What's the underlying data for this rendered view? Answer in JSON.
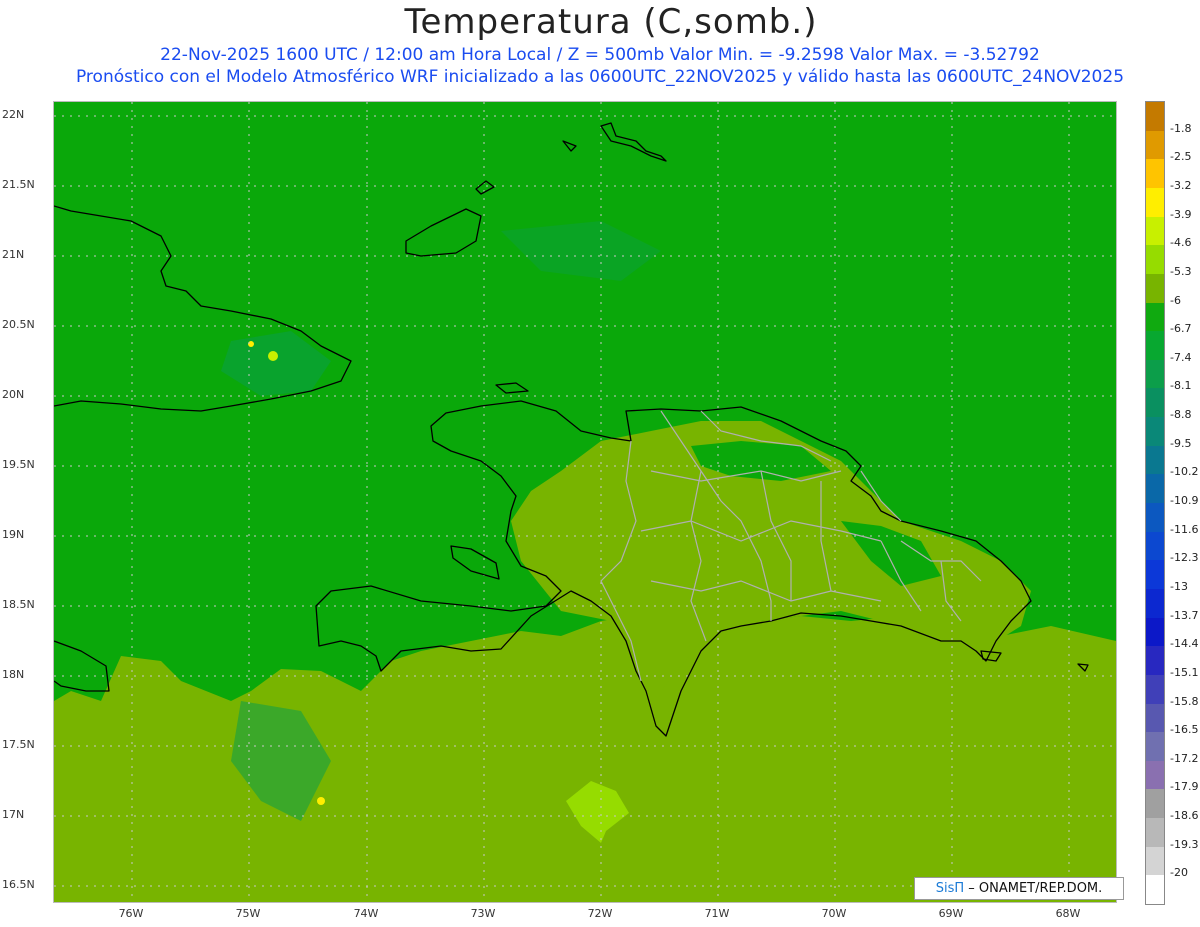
{
  "header": {
    "title": "Temperatura (C,somb.)",
    "line1": "22-Nov-2025  1600 UTC / 12:00 am Hora Local / Z = 500mb  Valor Min. = -9.2598  Valor Max. = -3.52792",
    "line2": "Pronóstico con el Modelo Atmosférico WRF inicializado a las 0600UTC_22NOV2025 y válido hasta las  0600UTC_24NOV2025"
  },
  "axes": {
    "lat_labels": [
      "22N",
      "21.5N",
      "21N",
      "20.5N",
      "20N",
      "19.5N",
      "19N",
      "18.5N",
      "18N",
      "17.5N",
      "17N",
      "16.5N"
    ],
    "lon_labels": [
      "76W",
      "75W",
      "74W",
      "73W",
      "72W",
      "71W",
      "70W",
      "69W",
      "68W"
    ]
  },
  "colorbar": {
    "labels": [
      "-1.8",
      "-2.5",
      "-3.2",
      "-3.9",
      "-4.6",
      "-5.3",
      "-6",
      "-6.7",
      "-7.4",
      "-8.1",
      "-8.8",
      "-9.5",
      "-10.2",
      "-10.9",
      "-11.6",
      "-12.3",
      "-13",
      "-13.7",
      "-14.4",
      "-15.1",
      "-15.8",
      "-16.5",
      "-17.2",
      "-17.9",
      "-18.6",
      "-19.3",
      "-20"
    ],
    "colors": [
      "#c47a00",
      "#e09a00",
      "#ffc400",
      "#ffee00",
      "#c8f000",
      "#96dc00",
      "#78b400",
      "#10aa10",
      "#08a830",
      "#0c9e4a",
      "#0a9060",
      "#0a8878",
      "#0a7890",
      "#0a68a8",
      "#0c58c0",
      "#0c48d0",
      "#0c38d8",
      "#0c28d0",
      "#0c18c8",
      "#2828c0",
      "#4040b8",
      "#5858b0",
      "#7070b0",
      "#8a70b0",
      "#a0a0a0",
      "#b8b8b8",
      "#d4d4d4",
      "#ffffff"
    ]
  },
  "map": {
    "colors": {
      "green_main": "#0aa80a",
      "olive": "#78b400",
      "lime": "#96dc00",
      "teal": "#0a9e4a",
      "coast": "#000000",
      "borders": "#b0b0b0",
      "grid": "#c8c8c8"
    }
  },
  "credit": {
    "brand": "SisΠ",
    "text": " – ONAMET/REP.DOM."
  }
}
